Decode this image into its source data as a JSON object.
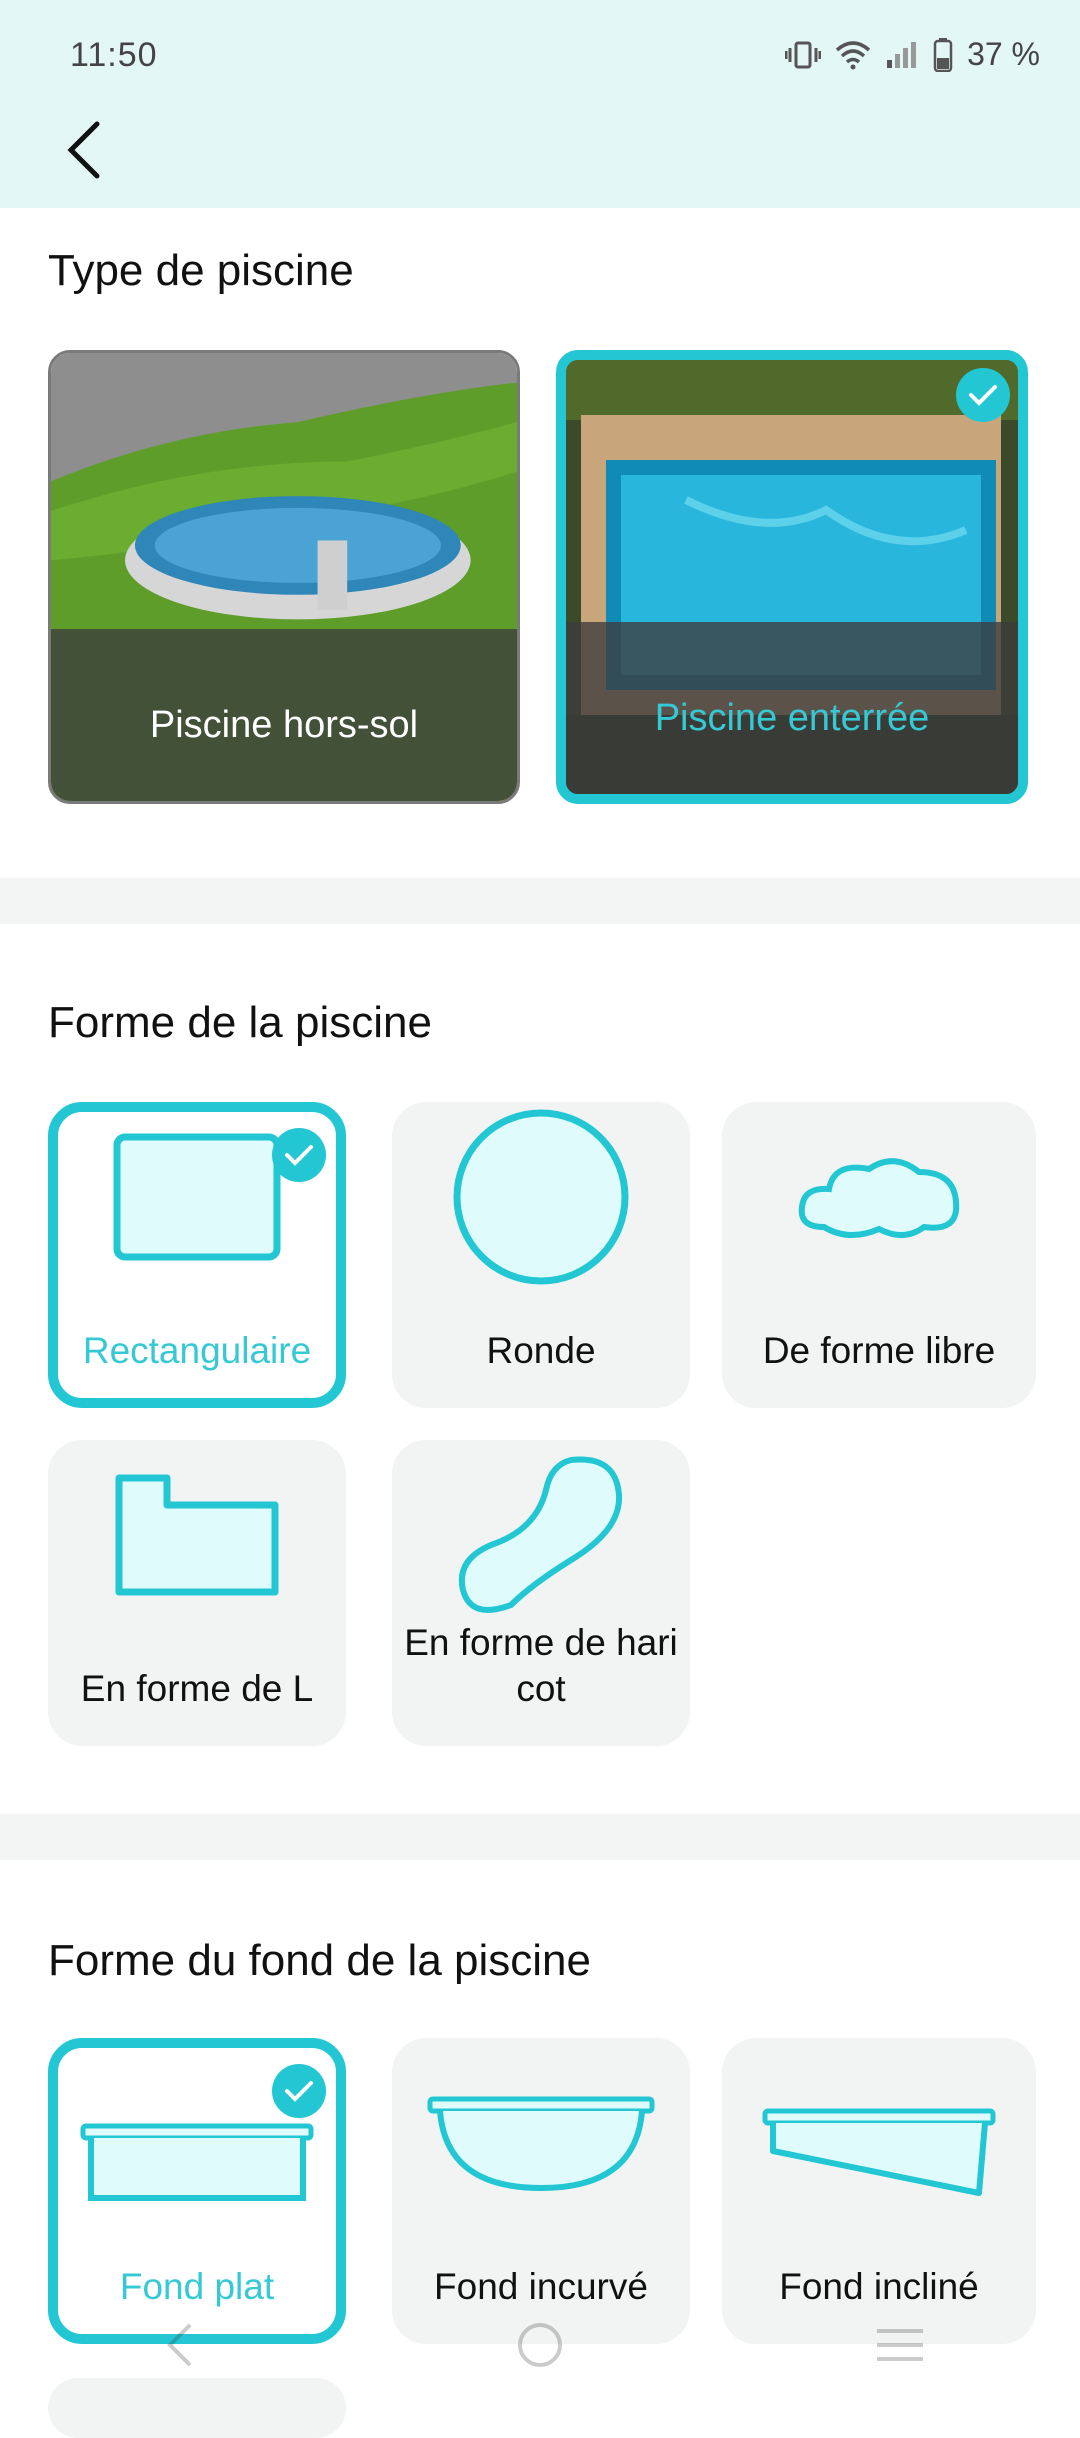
{
  "status": {
    "time": "11:50",
    "battery": "37 %"
  },
  "sections": {
    "type_title": "Type de piscine",
    "shape_title": "Forme de la piscine",
    "bottom_title": "Forme du fond de la piscine"
  },
  "pool_types": [
    {
      "label": "Piscine hors-sol",
      "selected": false
    },
    {
      "label": "Piscine enterrée",
      "selected": true
    }
  ],
  "pool_shapes": [
    {
      "label": "Rectangulaire",
      "selected": true,
      "icon": "rectangle-pool-icon"
    },
    {
      "label": "Ronde",
      "selected": false,
      "icon": "round-pool-icon"
    },
    {
      "label": "De forme libre",
      "selected": false,
      "icon": "freeform-pool-icon"
    },
    {
      "label": "En forme de L",
      "selected": false,
      "icon": "l-shape-pool-icon"
    },
    {
      "label": "En forme de haricot",
      "selected": false,
      "icon": "bean-shape-pool-icon"
    }
  ],
  "pool_bottoms": [
    {
      "label": "Fond plat",
      "selected": true,
      "icon": "flat-bottom-icon"
    },
    {
      "label": "Fond incurvé",
      "selected": false,
      "icon": "curved-bottom-icon"
    },
    {
      "label": "Fond incliné",
      "selected": false,
      "icon": "sloped-bottom-icon"
    }
  ],
  "colors": {
    "accent": "#22c7d3",
    "header_bg": "#e3f7f5",
    "card_bg": "#f2f4f4"
  }
}
